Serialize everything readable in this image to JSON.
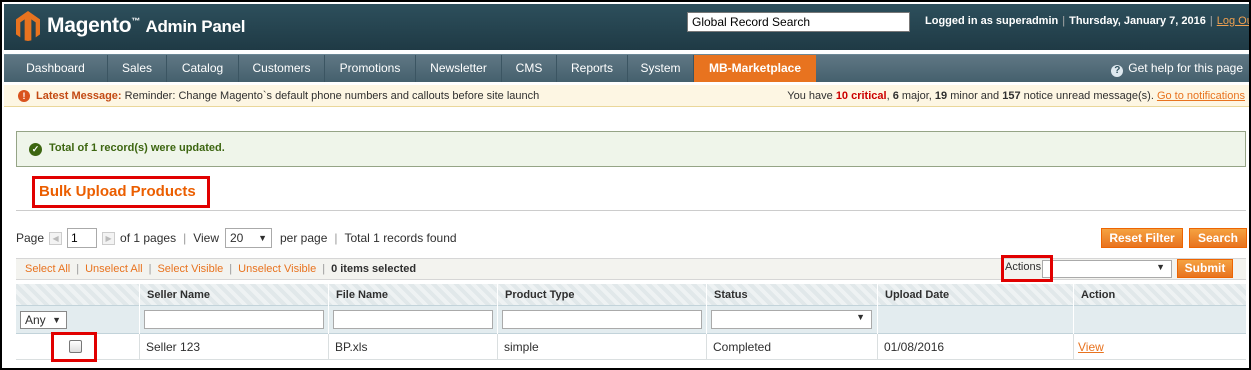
{
  "header": {
    "logo_brand": "Magento",
    "logo_tm": "™",
    "logo_sub": "Admin Panel",
    "search_value": "Global Record Search",
    "logged_in": "Logged in as superadmin",
    "date": "Thursday, January 7, 2016",
    "logout": "Log Out"
  },
  "nav": {
    "items": [
      "Dashboard",
      "Sales",
      "Catalog",
      "Customers",
      "Promotions",
      "Newsletter",
      "CMS",
      "Reports",
      "System",
      "MB-Marketplace"
    ],
    "active": "MB-Marketplace",
    "help": "Get help for this page"
  },
  "message": {
    "label": "Latest Message:",
    "text": "Reminder: Change Magento`s default phone numbers and callouts before site launch",
    "counts_prefix": "You have",
    "critical": "10 critical",
    "major_count": "6",
    "major_label": "major,",
    "minor_count": "19",
    "minor_label": "minor and",
    "notice_count": "157",
    "notice_label": "notice unread message(s).",
    "link": "Go to notifications"
  },
  "success": {
    "text": "Total of 1 record(s) were updated."
  },
  "page": {
    "title": "Bulk Upload Products"
  },
  "pager": {
    "page_label": "Page",
    "page_value": "1",
    "of_pages": "of 1 pages",
    "view_label": "View",
    "view_value": "20",
    "per_page": "per page",
    "total": "Total 1 records found",
    "reset_filter": "Reset Filter",
    "search": "Search"
  },
  "massaction": {
    "select_all": "Select All",
    "unselect_all": "Unselect All",
    "select_visible": "Select Visible",
    "unselect_visible": "Unselect Visible",
    "items_selected": "0 items selected",
    "actions_label": "Actions",
    "submit": "Submit"
  },
  "grid": {
    "columns": [
      "",
      "Seller Name",
      "File Name",
      "Product Type",
      "Status",
      "Upload Date",
      "Action"
    ],
    "filter_any": "Any",
    "rows": [
      {
        "seller": "Seller 123",
        "file": "BP.xls",
        "type": "simple",
        "status": "Completed",
        "date": "01/08/2016",
        "action": "View"
      }
    ]
  },
  "colors": {
    "accent": "#e8731f",
    "header_bg": "#2d4f5c",
    "highlight": "#e10000",
    "success": "#3d6611"
  },
  "icons": {
    "logo": "magento-logo-icon",
    "help": "help-icon",
    "message": "alert-icon",
    "success": "check-icon"
  }
}
